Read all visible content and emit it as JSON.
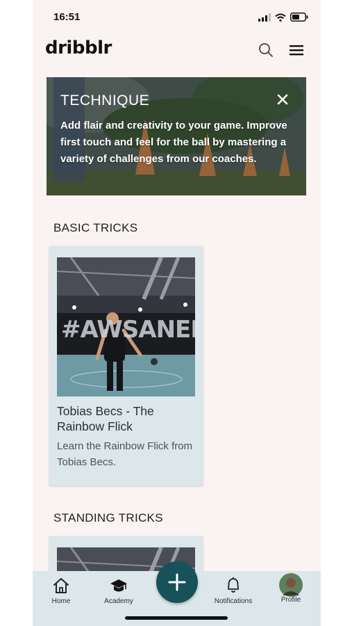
{
  "status_bar": {
    "time": "16:51"
  },
  "header": {
    "logo": "dribblr",
    "search_icon": "search-icon",
    "menu_icon": "hamburger-menu-icon"
  },
  "banner": {
    "title": "TECHNIQUE",
    "text": "Add flair and creativity to your game. Improve first touch and feel for the ball by mastering a variety of challenges from our coaches.",
    "close_icon": "close-icon"
  },
  "sections": [
    {
      "title": "BASIC TRICKS",
      "cards": [
        {
          "title": "Tobias Becs - The Rainbow Flick",
          "description": "Learn the Rainbow Flick from Tobias Becs.",
          "image_wall_text": "#AWSANEN"
        }
      ]
    },
    {
      "title": "STANDING TRICKS",
      "cards": [
        {
          "title": "",
          "description": ""
        }
      ]
    }
  ],
  "bottom_nav": {
    "items": [
      {
        "label": "Home",
        "icon": "home-icon"
      },
      {
        "label": "Academy",
        "icon": "graduation-cap-icon"
      },
      {
        "label": "Notifications",
        "icon": "bell-icon"
      },
      {
        "label": "Profile",
        "icon": "avatar"
      }
    ],
    "fab_icon": "plus-icon"
  },
  "colors": {
    "background": "#f9f3f1",
    "card": "#dbe7ea",
    "nav": "#dbe7ea",
    "accent": "#17525a"
  }
}
